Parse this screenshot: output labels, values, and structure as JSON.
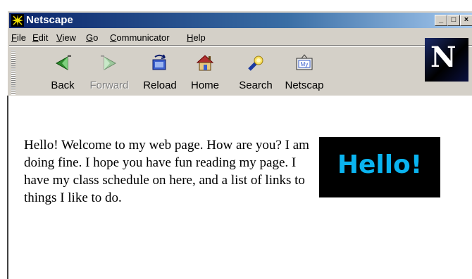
{
  "window": {
    "title": "Netscape",
    "buttons": [
      "_",
      "□",
      "×"
    ]
  },
  "menu": [
    {
      "label": "File",
      "u": "F",
      "rest": "ile"
    },
    {
      "label": "Edit",
      "u": "E",
      "rest": "dit"
    },
    {
      "label": "View",
      "u": "V",
      "rest": "iew"
    },
    {
      "label": "Go",
      "u": "G",
      "rest": "o"
    },
    {
      "label": "Communicator",
      "u": "C",
      "rest": "ommunicator"
    },
    {
      "label": "Help",
      "u": "H",
      "rest": "elp"
    }
  ],
  "toolbar": {
    "back": "Back",
    "forward": "Forward",
    "reload": "Reload",
    "home": "Home",
    "search": "Search",
    "netscape": "Netscap"
  },
  "logo_letter": "N",
  "page": {
    "image_text": "Hello!",
    "paragraph": "Hello! Welcome to my web page. How are you? I am doing fine. I hope you have fun reading my page. I have my class schedule on here, and a list of links to things I like to do."
  },
  "colors": {
    "title_gradient_start": "#0a246a",
    "chrome": "#d4d0c8",
    "hello_text": "#0ab4f0"
  }
}
